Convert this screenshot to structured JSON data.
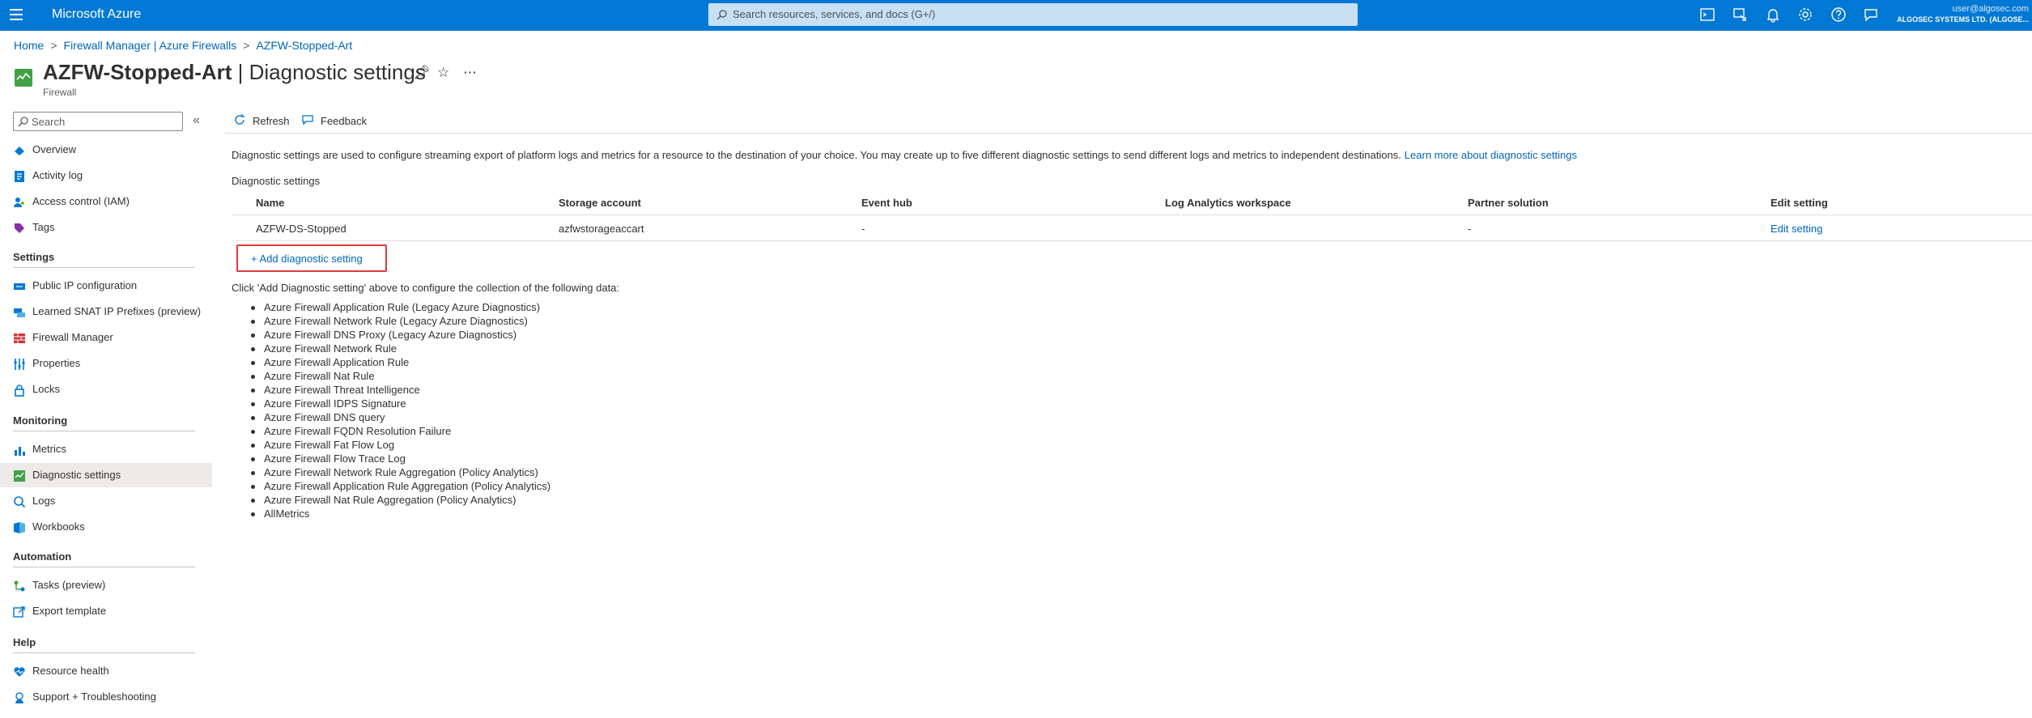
{
  "topbar": {
    "brand": "Microsoft Azure",
    "search_placeholder": "Search resources, services, and docs (G+/)",
    "account_email": "user@algosec.com",
    "account_org": "ALGOSEC SYSTEMS LTD. (ALGOSE...",
    "icons": [
      "cloud-shell-icon",
      "directory-filter-icon",
      "notifications-icon",
      "settings-icon",
      "help-icon",
      "feedback-icon"
    ]
  },
  "breadcrumb": {
    "items": [
      "Home",
      "Firewall Manager | Azure Firewalls",
      "AZFW-Stopped-Art"
    ]
  },
  "header": {
    "resource_name": "AZFW-Stopped-Art",
    "page_name": "| Diagnostic settings",
    "resource_type": "Firewall"
  },
  "sidebar": {
    "search_placeholder": "Search",
    "items_top": [
      "Overview",
      "Activity log",
      "Access control (IAM)",
      "Tags"
    ],
    "sections": [
      {
        "title": "Settings",
        "items": [
          "Public IP configuration",
          "Learned SNAT IP Prefixes (preview)",
          "Firewall Manager",
          "Properties",
          "Locks"
        ]
      },
      {
        "title": "Monitoring",
        "items": [
          "Metrics",
          "Diagnostic settings",
          "Logs",
          "Workbooks"
        ]
      },
      {
        "title": "Automation",
        "items": [
          "Tasks (preview)",
          "Export template"
        ]
      },
      {
        "title": "Help",
        "items": [
          "Resource health",
          "Support + Troubleshooting"
        ]
      }
    ],
    "active_item": "Diagnostic settings"
  },
  "toolbar": {
    "refresh_label": "Refresh",
    "feedback_label": "Feedback"
  },
  "main": {
    "description": "Diagnostic settings are used to configure streaming export of platform logs and metrics for a resource to the destination of your choice. You may create up to five different diagnostic settings to send different logs and metrics to independent destinations.",
    "learn_more_link": "Learn more about diagnostic settings",
    "section_label": "Diagnostic settings",
    "table": {
      "columns": [
        "Name",
        "Storage account",
        "Event hub",
        "Log Analytics workspace",
        "Partner solution",
        "Edit setting"
      ],
      "rows": [
        {
          "name": "AZFW-DS-Stopped",
          "storage": "azfwstorageaccart",
          "event_hub": "-",
          "log_analytics": "",
          "partner": "-",
          "edit": "Edit setting"
        }
      ]
    },
    "add_setting_label": "+ Add diagnostic setting",
    "click_note": "Click 'Add Diagnostic setting' above to configure the collection of the following data:",
    "categories": [
      "Azure Firewall Application Rule (Legacy Azure Diagnostics)",
      "Azure Firewall Network Rule (Legacy Azure Diagnostics)",
      "Azure Firewall DNS Proxy (Legacy Azure Diagnostics)",
      "Azure Firewall Network Rule",
      "Azure Firewall Application Rule",
      "Azure Firewall Nat Rule",
      "Azure Firewall Threat Intelligence",
      "Azure Firewall IDPS Signature",
      "Azure Firewall DNS query",
      "Azure Firewall FQDN Resolution Failure",
      "Azure Firewall Fat Flow Log",
      "Azure Firewall Flow Trace Log",
      "Azure Firewall Network Rule Aggregation (Policy Analytics)",
      "Azure Firewall Application Rule Aggregation (Policy Analytics)",
      "Azure Firewall Nat Rule Aggregation (Policy Analytics)",
      "AllMetrics"
    ]
  },
  "colors": {
    "azure_blue": "#0078d4",
    "link": "#0066b8",
    "highlight_border": "#e13b3b",
    "active_nav": "#edebe9"
  }
}
